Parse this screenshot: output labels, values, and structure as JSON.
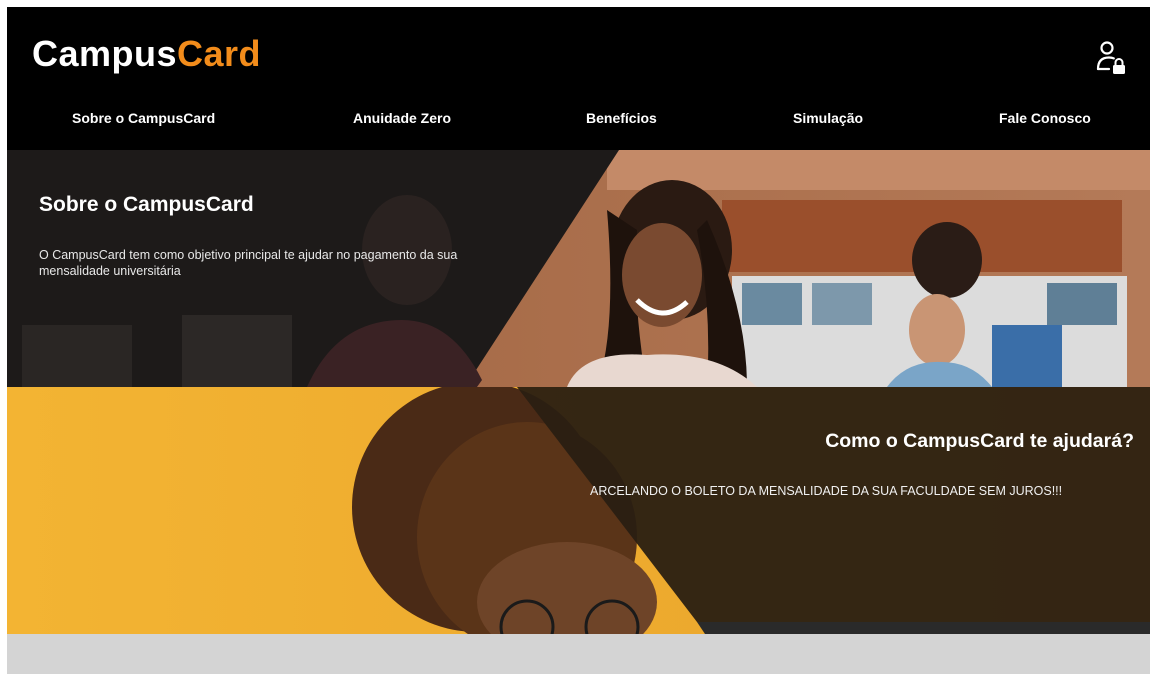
{
  "brand": {
    "part1": "Campus",
    "part2": "Card",
    "accent_color": "#f28c1b"
  },
  "header": {
    "user_icon": "user-lock-icon"
  },
  "nav": {
    "items": [
      {
        "label": "Sobre o CampusCard"
      },
      {
        "label": "Anuidade Zero"
      },
      {
        "label": "Benefícios"
      },
      {
        "label": "Simulação"
      },
      {
        "label": "Fale Conosco"
      }
    ]
  },
  "about": {
    "title": "Sobre o CampusCard",
    "description": "O CampusCard tem como objetivo principal te ajudar no pagamento da sua mensalidade universitária"
  },
  "help": {
    "title": "Como o CampusCard te ajudará?",
    "description": "ARCELANDO O BOLETO DA MENSALIDADE DA SUA FACULDADE SEM JUROS!!!"
  }
}
